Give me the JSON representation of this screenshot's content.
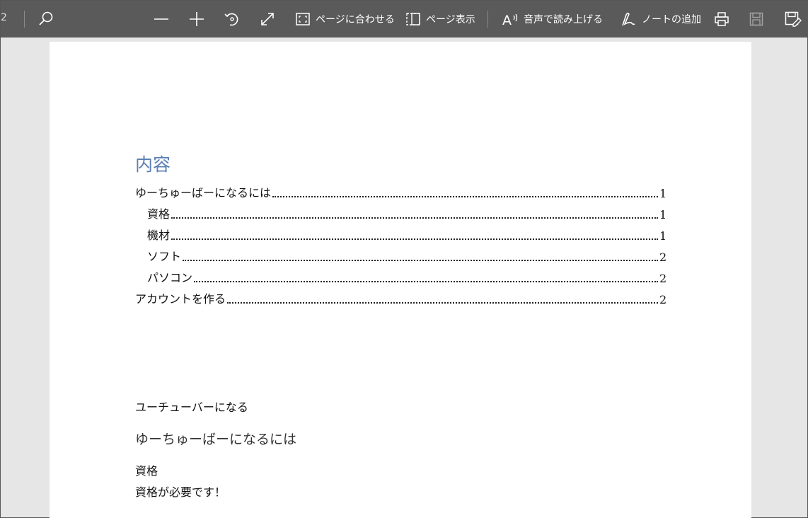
{
  "toolbar": {
    "page_indicator": "2",
    "fit_page_label": "ページに合わせる",
    "page_view_label": "ページ表示",
    "read_aloud_label": "音声で読み上げる",
    "add_notes_label": "ノートの追加"
  },
  "document": {
    "toc_heading": "内容",
    "toc": [
      {
        "text": "ゆーちゅーばーになるには",
        "page": "1",
        "level": 1
      },
      {
        "text": "資格",
        "page": "1",
        "level": 2
      },
      {
        "text": "機材",
        "page": "1",
        "level": 2
      },
      {
        "text": "ソフト",
        "page": "2",
        "level": 2
      },
      {
        "text": "パソコン",
        "page": "2",
        "level": 2
      },
      {
        "text": "アカウントを作る",
        "page": "2",
        "level": 1
      }
    ],
    "title_line": "ユーチューバーになる",
    "heading1": "ゆーちゅーばーになるには",
    "heading2": "資格",
    "paragraph": "資格が必要です！"
  },
  "colors": {
    "toolbar_bg": "#5a5a5a",
    "heading_blue": "#5b7fb5",
    "viewer_bg": "#e6e6e6"
  }
}
